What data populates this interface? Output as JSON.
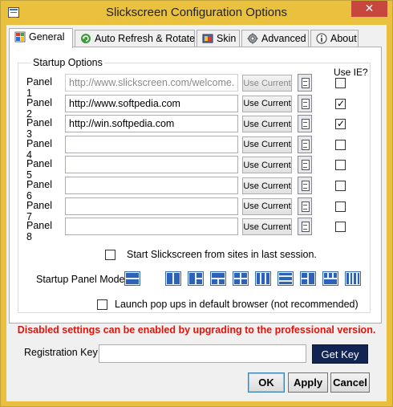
{
  "window": {
    "title": "Slickscreen Configuration Options",
    "close_glyph": "✕"
  },
  "tabs": [
    {
      "label": "General",
      "icon": "windows-flag-icon"
    },
    {
      "label": "Auto Refresh & Rotate",
      "icon": "refresh-icon"
    },
    {
      "label": "Skin",
      "icon": "skin-icon"
    },
    {
      "label": "Advanced",
      "icon": "gear-icon"
    },
    {
      "label": "About",
      "icon": "info-icon"
    }
  ],
  "startup": {
    "group_label": "Startup Options",
    "use_ie_label": "Use IE?",
    "use_current_label": "Use Current",
    "panels": [
      {
        "label": "Panel 1",
        "url": "http://www.slickscreen.com/welcome.as",
        "disabled": true,
        "use_ie": false
      },
      {
        "label": "Panel 2",
        "url": "http://www.softpedia.com",
        "disabled": false,
        "use_ie": true
      },
      {
        "label": "Panel 3",
        "url": "http://win.softpedia.com",
        "disabled": false,
        "use_ie": true
      },
      {
        "label": "Panel 4",
        "url": "",
        "disabled": false,
        "use_ie": false
      },
      {
        "label": "Panel 5",
        "url": "",
        "disabled": false,
        "use_ie": false
      },
      {
        "label": "Panel 6",
        "url": "",
        "disabled": false,
        "use_ie": false
      },
      {
        "label": "Panel 7",
        "url": "",
        "disabled": false,
        "use_ie": false
      },
      {
        "label": "Panel 8",
        "url": "",
        "disabled": false,
        "use_ie": false
      }
    ],
    "session_label": "Start Slickscreen from sites in last session.",
    "session_checked": false,
    "mode_label": "Startup Panel Mode:"
  },
  "popups": {
    "label": "Launch pop ups in default browser (not recommended)",
    "checked": false
  },
  "warning": "Disabled settings can be enabled by upgrading to the professional version.",
  "registration": {
    "label": "Registration Key",
    "value": "",
    "get_key_label": "Get Key"
  },
  "buttons": {
    "ok": "OK",
    "apply": "Apply",
    "cancel": "Cancel"
  },
  "colors": {
    "titlebar": "#e9c13f",
    "warning": "#e0140c",
    "get_key_bg": "#122452"
  }
}
